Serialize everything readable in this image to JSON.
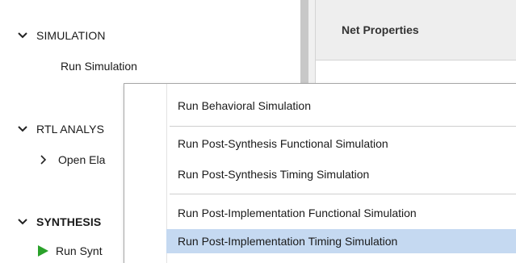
{
  "flow_navigator": {
    "simulation": {
      "section_label": "SIMULATION",
      "run_simulation": "Run Simulation"
    },
    "rtl_analysis": {
      "section_label": "RTL ANALYS",
      "open_elaborated": "Open Ela"
    },
    "synthesis": {
      "section_label": "SYNTHESIS",
      "run_synthesis": "Run Synt"
    }
  },
  "net_properties": {
    "title": "Net Properties"
  },
  "context_menu": {
    "items": [
      {
        "label": "Run Behavioral Simulation"
      },
      {
        "label": "Run Post-Synthesis Functional Simulation"
      },
      {
        "label": "Run Post-Synthesis Timing Simulation"
      },
      {
        "label": "Run Post-Implementation Functional Simulation"
      },
      {
        "label": "Run Post-Implementation Timing Simulation",
        "highlighted": true
      }
    ],
    "highlight_color": "#c5d9f1"
  },
  "colors": {
    "run_icon": "#2aa12a"
  },
  "icons": [
    "chevron-down-icon",
    "chevron-right-icon",
    "run-play-icon"
  ]
}
